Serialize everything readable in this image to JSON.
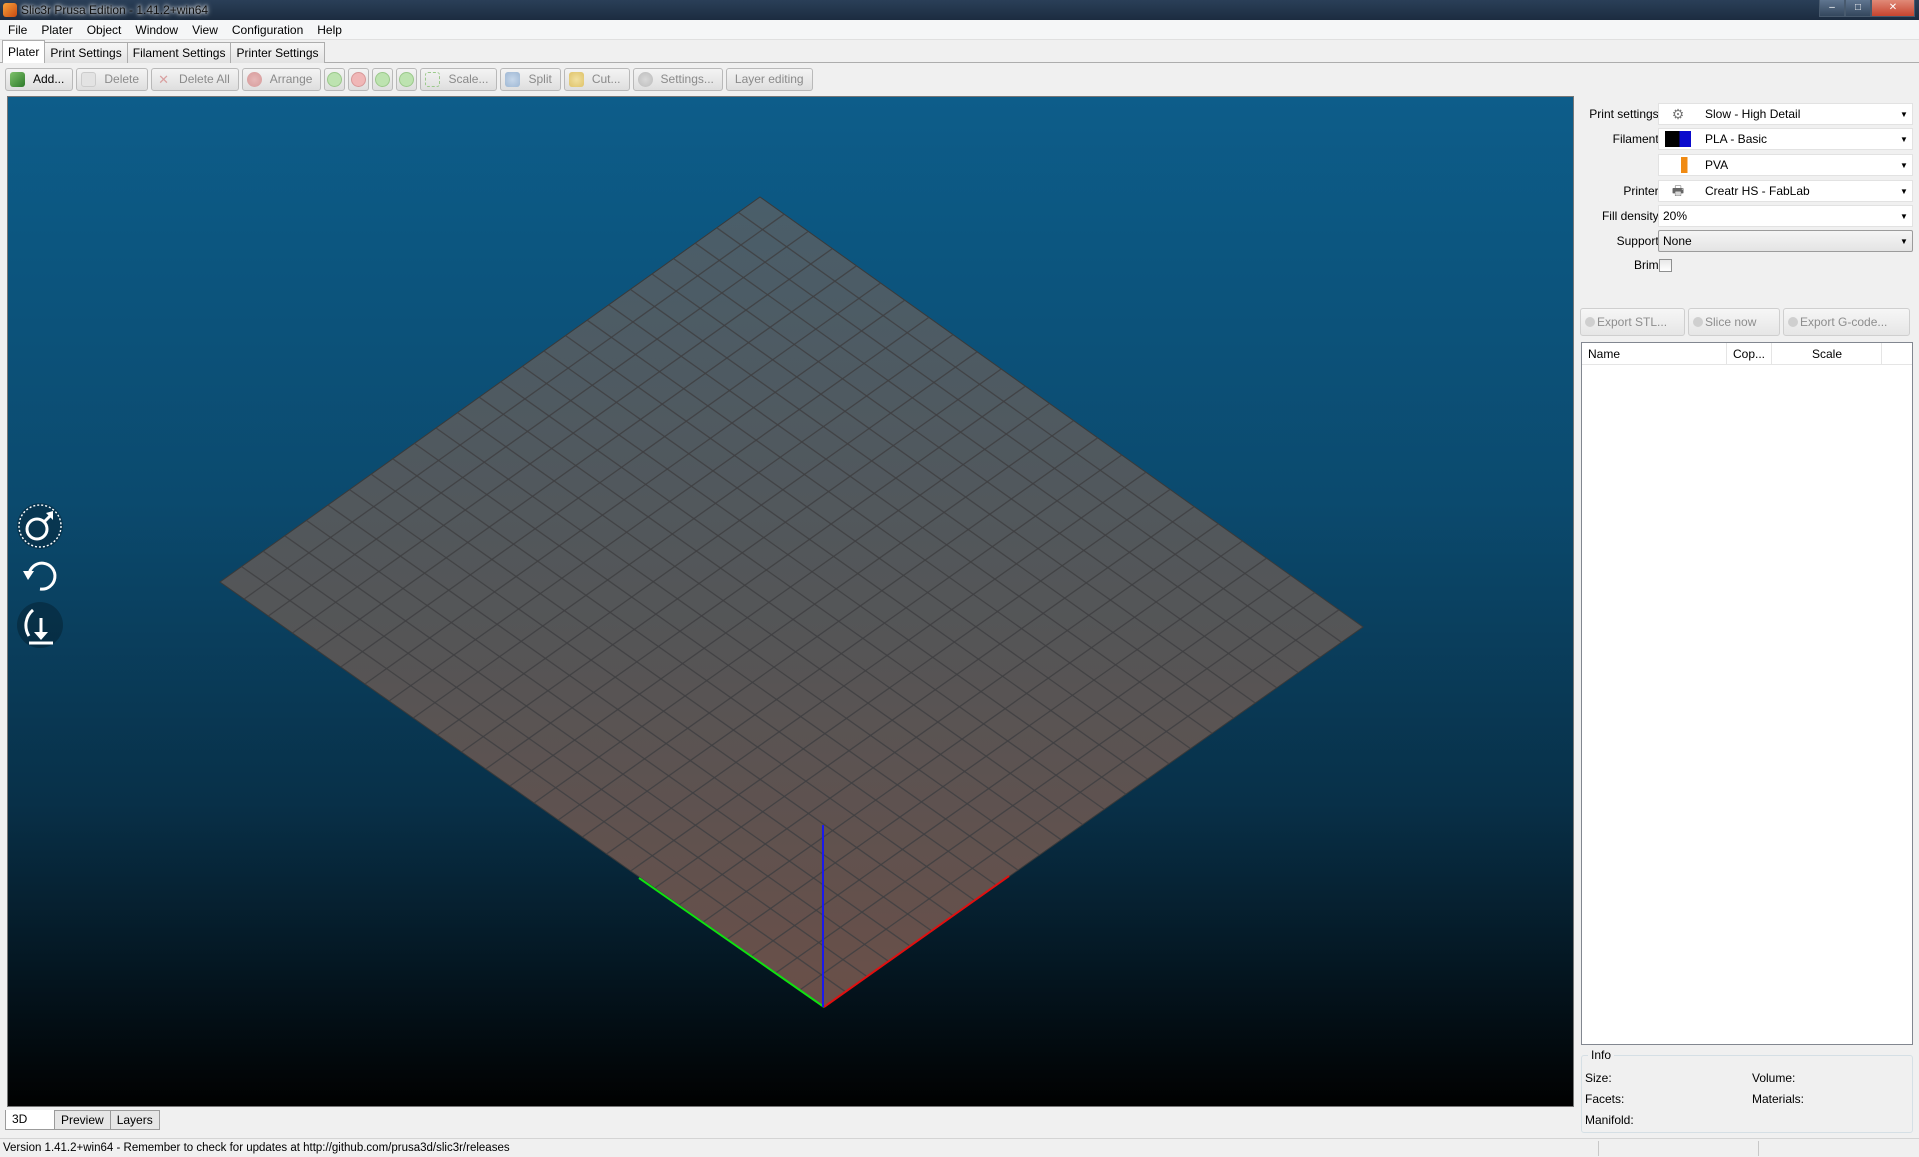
{
  "window": {
    "title": "Slic3r Prusa Edition - 1.41.2+win64",
    "controls": [
      "–",
      "□",
      "✕"
    ]
  },
  "menu": [
    "File",
    "Plater",
    "Object",
    "Window",
    "View",
    "Configuration",
    "Help"
  ],
  "tabs": [
    "Plater",
    "Print Settings",
    "Filament Settings",
    "Printer Settings"
  ],
  "toolbar": {
    "add": "Add...",
    "delete": "Delete",
    "delete_all": "Delete All",
    "arrange": "Arrange",
    "scale": "Scale...",
    "split": "Split",
    "cut": "Cut...",
    "settings": "Settings...",
    "layer_editing": "Layer editing"
  },
  "view_tabs": [
    "3D",
    "Preview",
    "Layers"
  ],
  "status_bar": "Version 1.41.2+win64 - Remember to check for updates at http://github.com/prusa3d/slic3r/releases",
  "settings": {
    "print_label": "Print settings:",
    "print_value": "Slow - High Detail",
    "filament_label": "Filament:",
    "filament_value": "PLA - Basic",
    "filament2_value": "PVA",
    "printer_label": "Printer:",
    "printer_value": "Creatr HS - FabLab",
    "fill_label": "Fill density:",
    "fill_value": "20%",
    "support_label": "Support:",
    "support_value": "None",
    "brim_label": "Brim:",
    "brim_checked": false
  },
  "export": {
    "stl": "Export STL...",
    "slice": "Slice now",
    "gcode": "Export G-code..."
  },
  "object_list": {
    "columns": [
      "Name",
      "Cop...",
      "Scale"
    ]
  },
  "info": {
    "legend": "Info",
    "size": "Size:",
    "volume": "Volume:",
    "facets": "Facets:",
    "materials": "Materials:",
    "manifold": "Manifold:"
  },
  "colors": {
    "filament1": "#0a0acc",
    "filament2": "#f08a12",
    "axis_x": "#e01010",
    "axis_y": "#10e010",
    "axis_z": "#1a1aee"
  }
}
